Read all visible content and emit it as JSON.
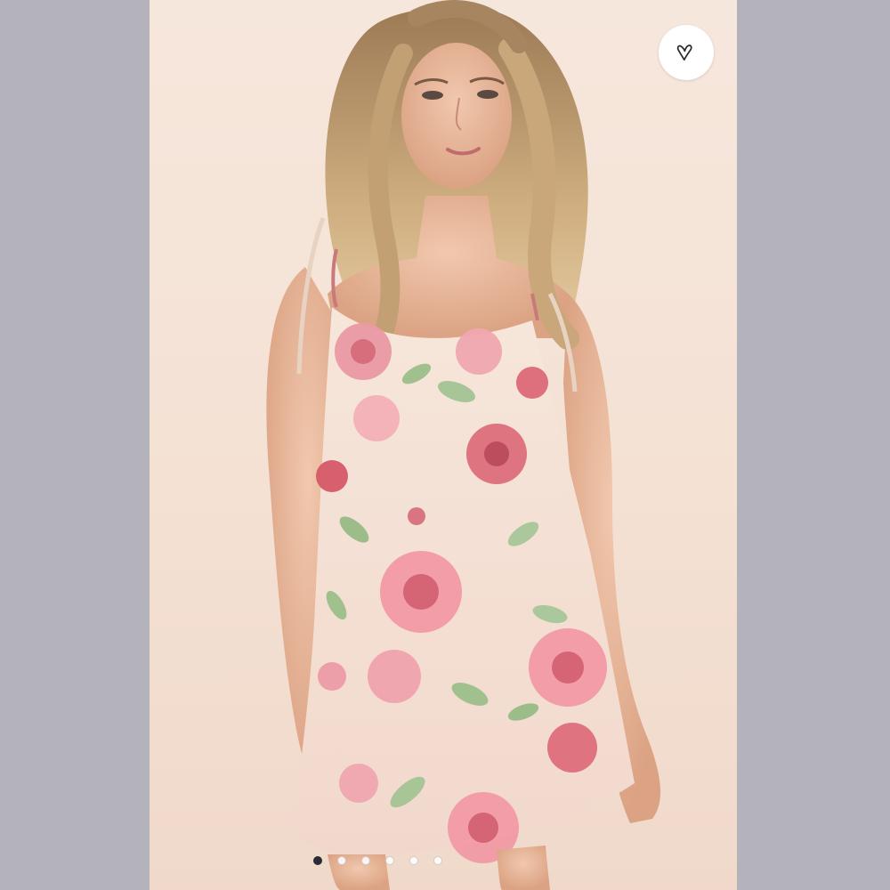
{
  "viewer": {
    "image": {
      "subject": "model-in-floral-slip-dress",
      "background_color": "#f4e1d4"
    },
    "favorite_button": {
      "icon": "heart-outline-icon"
    },
    "carousel": {
      "total": 6,
      "active_index": 0
    },
    "sidebar_color": "#b4b3bb"
  }
}
